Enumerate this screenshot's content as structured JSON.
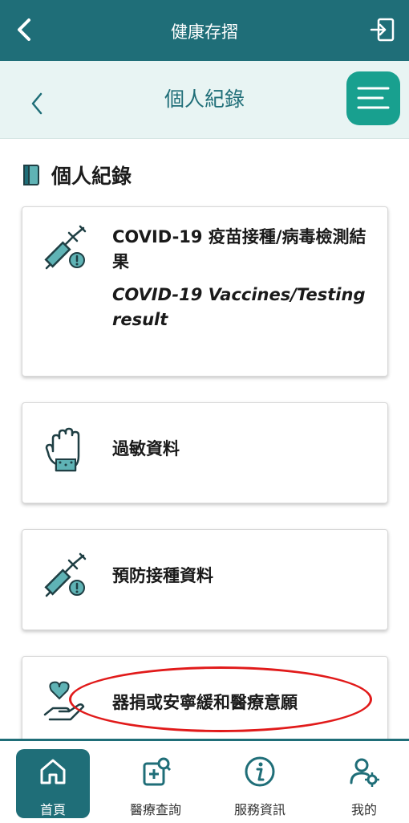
{
  "header": {
    "title": "健康存摺"
  },
  "subheader": {
    "title": "個人紀錄"
  },
  "section": {
    "title": "個人紀錄"
  },
  "cards": [
    {
      "zh": "COVID-19 疫苗接種/病毒檢測結果",
      "en": "COVID-19 Vaccines/Testing result",
      "icon": "syringe-icon"
    },
    {
      "zh": "過敏資料",
      "icon": "glove-icon"
    },
    {
      "zh": "預防接種資料",
      "icon": "syringe-icon"
    },
    {
      "zh": "器捐或安寧緩和醫療意願",
      "icon": "heart-hand-icon"
    }
  ],
  "tabs": [
    {
      "label": "首頁",
      "icon": "home-icon",
      "active": true
    },
    {
      "label": "醫療查詢",
      "icon": "medical-search-icon"
    },
    {
      "label": "服務資訊",
      "icon": "info-icon"
    },
    {
      "label": "我的",
      "icon": "user-settings-icon"
    }
  ],
  "colors": {
    "primary": "#1f6e78",
    "accent": "#18a08f",
    "subbar_bg": "#e8f4f3",
    "highlight": "#e11a1a"
  }
}
